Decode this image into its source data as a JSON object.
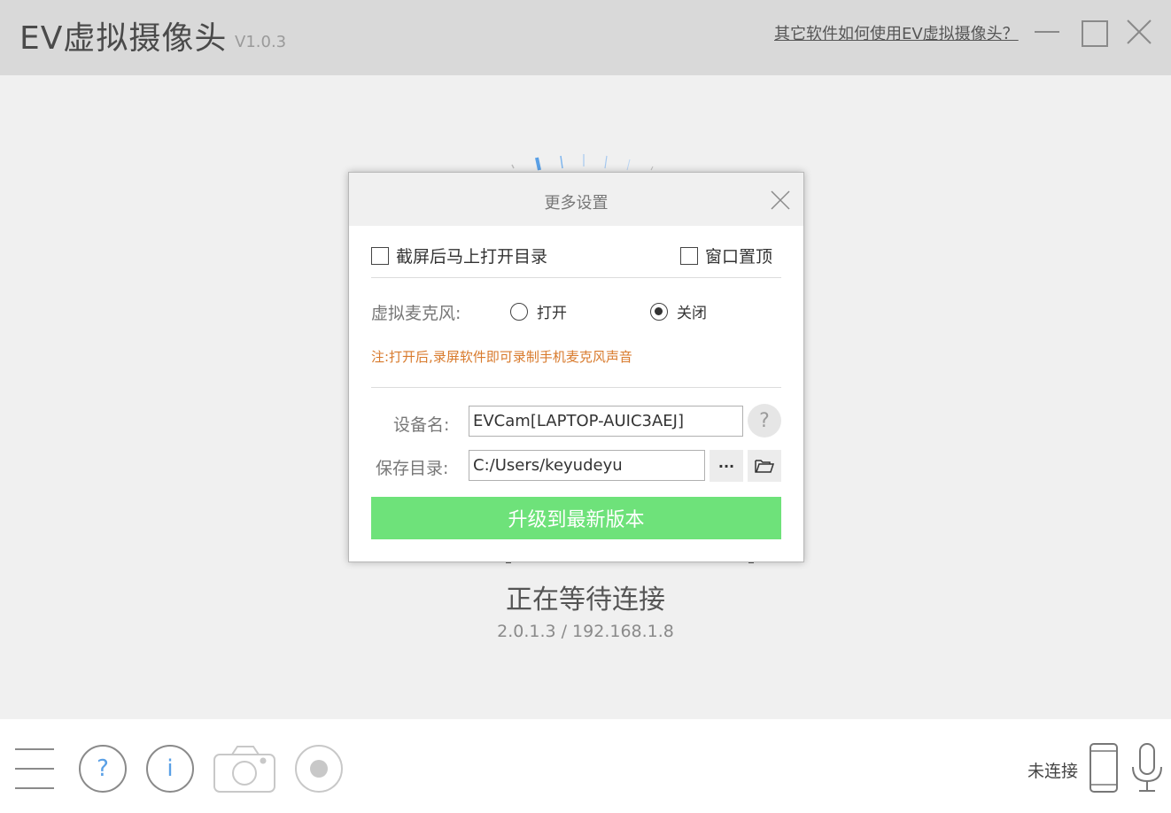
{
  "app": {
    "title": "EV虚拟摄像头",
    "version": "V1.0.3",
    "help_link": "其它软件如何使用EV虚拟摄像头？"
  },
  "window_controls": [
    "minimize-icon",
    "maximize-icon",
    "close-icon"
  ],
  "main": {
    "status_title": "正在等待连接",
    "status_sub": "2.0.1.3 / 192.168.1.8"
  },
  "dialog": {
    "title": "更多设置",
    "open_dir_after_screenshot": {
      "label": "截屏后马上打开目录",
      "checked": false
    },
    "window_on_top": {
      "label": "窗口置顶",
      "checked": false
    },
    "virtual_mic": {
      "label": "虚拟麦克风:",
      "options": [
        {
          "label": "打开",
          "selected": false
        },
        {
          "label": "关闭",
          "selected": true
        }
      ]
    },
    "note": "注:打开后,录屏软件即可录制手机麦克风声音",
    "device_name": {
      "label": "设备名:",
      "value": "EVCam[LAPTOP-AUIC3AEJ]",
      "help": "?"
    },
    "save_dir": {
      "label": "保存目录:",
      "value": "C:/Users/keyudeyu",
      "browse": "···"
    },
    "upgrade_button": "升级到最新版本"
  },
  "bottom": {
    "icons": [
      "menu-icon",
      "help-icon",
      "info-icon",
      "camera-icon",
      "record-icon"
    ],
    "help_glyph": "?",
    "info_glyph": "i",
    "connection_status": "未连接",
    "right_icons": [
      "phone-icon",
      "microphone-icon"
    ]
  },
  "colors": {
    "titlebar": "#d9d9d9",
    "accent_green": "#6ee27a",
    "note_orange": "#d87a2c",
    "icon_gray": "#bdbdbd",
    "icon_blue": "#5aa0e6"
  }
}
